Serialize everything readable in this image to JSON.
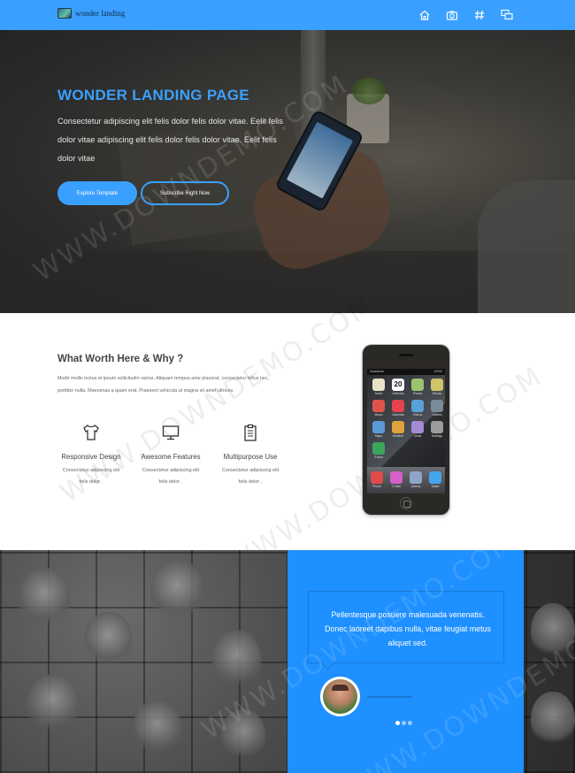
{
  "nav": {
    "logo_text": "wonder landing",
    "icons": [
      "home-icon",
      "camera-icon",
      "hashtag-icon",
      "chat-icon"
    ],
    "color": "#3aa0ff"
  },
  "hero": {
    "title": "WONDER LANDING PAGE",
    "text": "Consectetur adipiscing elit felis dolor felis dolor vitae. Eelit felis dolor vitae adipiscing elit felis dolor felis dolor vitae. Eelit felis dolor vitae",
    "primary_button": "Explore Template",
    "secondary_button": "Subscribe Right Now"
  },
  "features": {
    "title": "What Worth Here & Why ?",
    "text": "Morbi mollis lectus et ipsum sollicitudin varius. Aliquam tempus ante placerat, consectetur tellus nec, porttitor nulla. Maecenas a quam erat. Praesent vehicula ut magna sit amet ultrices.",
    "items": [
      {
        "icon": "tshirt-icon",
        "name": "Responsive Design",
        "desc": "Consectetur adipiscing elit felis dolor ."
      },
      {
        "icon": "monitor-icon",
        "name": "Awesome Features",
        "desc": "Consectetur adipiscing elit felis dolor ."
      },
      {
        "icon": "clipboard-icon",
        "name": "Multipurpose Use",
        "desc": "Consectetur adipiscing elit felis dolor ."
      }
    ],
    "phone": {
      "status_left": "Vodafone",
      "status_right": "100%",
      "apps": [
        {
          "label": "Notes",
          "color": "#e9e2c7"
        },
        {
          "label": "Calendar",
          "color": "#ffffff"
        },
        {
          "label": "Photos",
          "color": "#9bc46d"
        },
        {
          "label": "Stocks",
          "color": "#cfc46a"
        },
        {
          "label": "Music",
          "color": "#e0534a"
        },
        {
          "label": "Calendar",
          "color": "#e5434f"
        },
        {
          "label": "Videos",
          "color": "#5aa1d8"
        },
        {
          "label": "Utilities",
          "color": "#7a8b98"
        },
        {
          "label": "Maps",
          "color": "#5c9ad6"
        },
        {
          "label": "Weather",
          "color": "#e0a33c"
        },
        {
          "label": "Clock",
          "color": "#a58ad6"
        },
        {
          "label": "Settings",
          "color": "#9c9c9c"
        },
        {
          "label": "iTunes",
          "color": "#3aa55b"
        }
      ],
      "dock": [
        {
          "label": "Phone",
          "color": "#e24b4b"
        },
        {
          "label": "E-Mail",
          "color": "#d660c9"
        },
        {
          "label": "Adress",
          "color": "#8fa6c9"
        },
        {
          "label": "Safari",
          "color": "#44a6ea"
        }
      ],
      "calendar_day": "20"
    }
  },
  "testimonial": {
    "quote": "Pellentesque posuere malesuada venenatis. Donec laoreet dapibus nulla, vitae feugiat metus aliquet sed.",
    "panel_color": "#1e90ff",
    "slides": 3,
    "active_slide": 1
  },
  "watermark": "WWW.DOWNDEMO.COM"
}
